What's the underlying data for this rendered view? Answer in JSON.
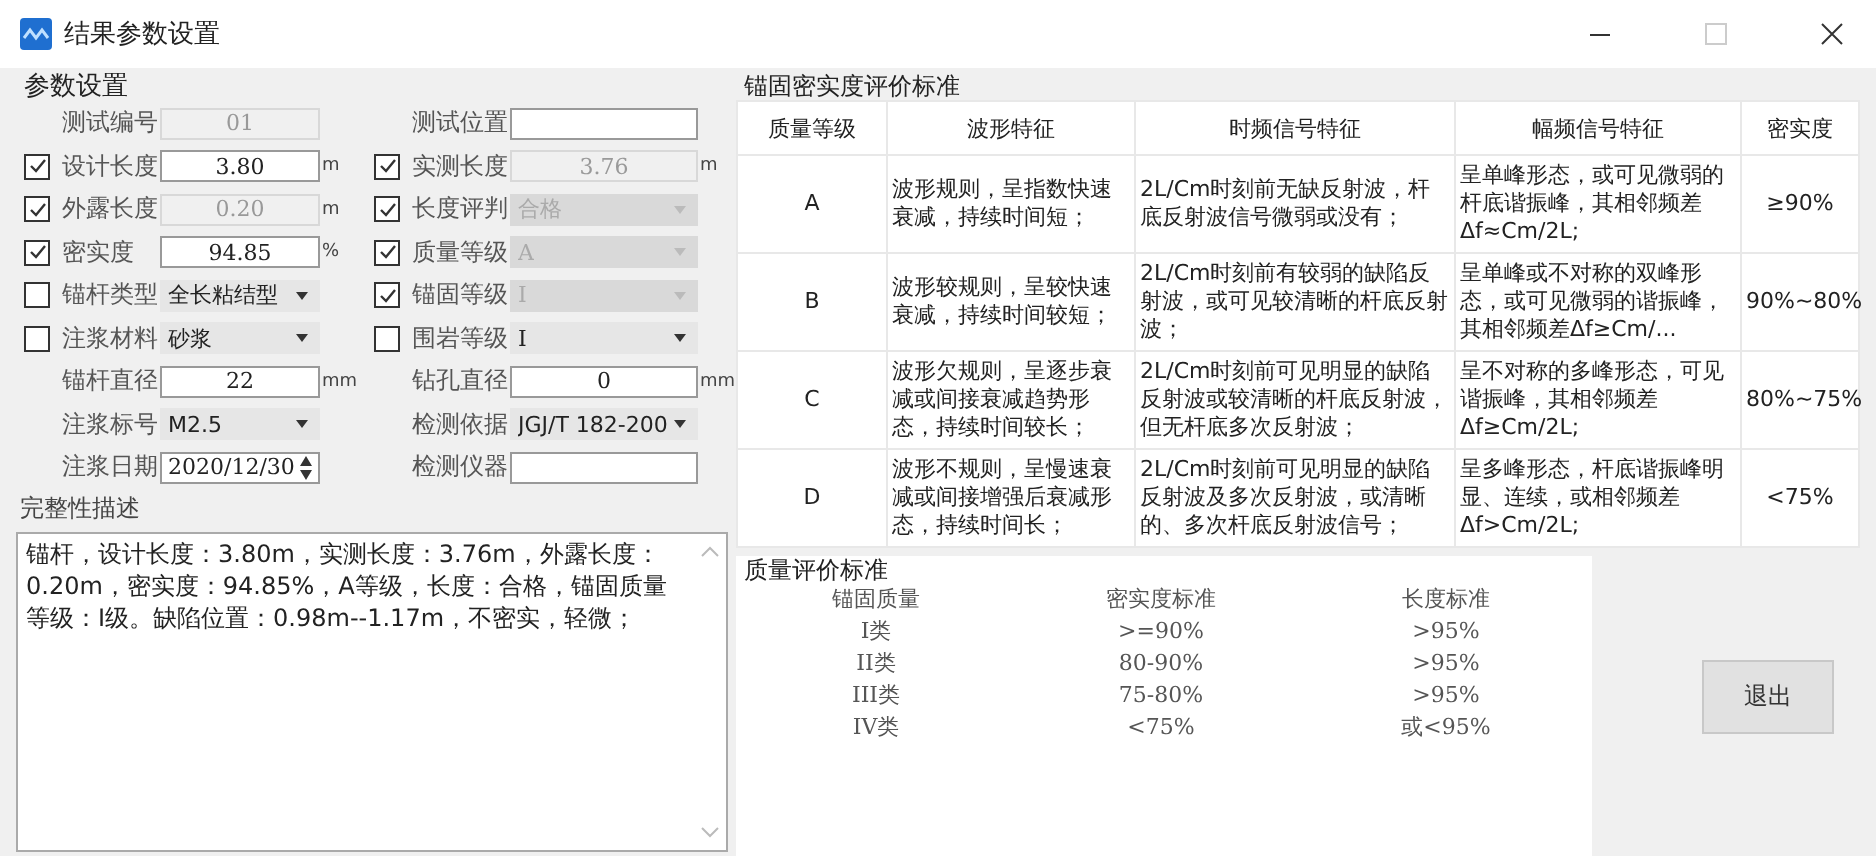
{
  "window": {
    "title": "结果参数设置"
  },
  "params": {
    "title": "参数设置",
    "rows": [
      {
        "left": {
          "label": "测试编号",
          "kind": "text",
          "value": "01",
          "disabled": true
        },
        "right": {
          "label": "测试位置",
          "kind": "text",
          "disabled": false
        }
      },
      {
        "left": {
          "label": "设计长度",
          "checked": true,
          "kind": "text",
          "value": "3.80",
          "disabled": false,
          "unit": "m"
        },
        "right": {
          "label": "实测长度",
          "checked": true,
          "kind": "text",
          "value": "3.76",
          "disabled": true,
          "unit": "m"
        }
      },
      {
        "left": {
          "label": "外露长度",
          "checked": true,
          "kind": "text",
          "value": "0.20",
          "disabled": true,
          "unit": "m"
        },
        "right": {
          "label": "长度评判",
          "checked": true,
          "kind": "select",
          "value": "合格",
          "disabled": true
        }
      },
      {
        "left": {
          "label": "密实度",
          "checked": true,
          "kind": "text",
          "value": "94.85",
          "disabled": false,
          "unit": "%"
        },
        "right": {
          "label": "质量等级",
          "checked": true,
          "kind": "select",
          "value": "A",
          "disabled": true
        }
      },
      {
        "left": {
          "label": "锚杆类型",
          "checked": false,
          "kind": "select",
          "value": "全长粘结型",
          "disabled": false
        },
        "right": {
          "label": "锚固等级",
          "checked": true,
          "kind": "select",
          "value": "I",
          "disabled": true
        }
      },
      {
        "left": {
          "label": "注浆材料",
          "checked": false,
          "kind": "select",
          "value": "砂浆",
          "disabled": false
        },
        "right": {
          "label": "围岩等级",
          "checked": false,
          "kind": "select",
          "value": "I",
          "disabled": false
        }
      },
      {
        "left": {
          "label": "锚杆直径",
          "kind": "text",
          "value": "22",
          "disabled": false,
          "unit": "mm"
        },
        "right": {
          "label": "钻孔直径",
          "kind": "text",
          "value": "0",
          "disabled": false,
          "unit": "mm"
        }
      },
      {
        "left": {
          "label": "注浆标号",
          "kind": "select",
          "value": "M2.5",
          "disabled": false
        },
        "right": {
          "label": "检测依据",
          "kind": "select",
          "value": "JGJ/T 182-200",
          "disabled": false
        }
      },
      {
        "left": {
          "label": "注浆日期",
          "kind": "date",
          "value": "2020/12/30",
          "disabled": false
        },
        "right": {
          "label": "检测仪器",
          "kind": "text",
          "disabled": false
        }
      }
    ],
    "description_label": "完整性描述",
    "description": "锚杆，设计长度：3.80m，实测长度：3.76m，外露长度：0.20m，密实度：94.85%，A等级，长度：合格，锚固质量等级：I级。缺陷位置：0.98m--1.17m，不密实，轻微；"
  },
  "density_standard": {
    "title": "锚固密实度评价标准",
    "columns": [
      "质量等级",
      "波形特征",
      "时频信号特征",
      "幅频信号特征",
      "密实度"
    ],
    "rows": [
      [
        "A",
        "波形规则，呈指数快速衰减，持续时间短；",
        "2L/Cm时刻前无缺反射波，杆底反射波信号微弱或没有；",
        "呈单峰形态，或可见微弱的杆底谐振峰，其相邻频差Δf≈Cm/2L;",
        "≥90%"
      ],
      [
        "B",
        "波形较规则，呈较快速衰减，持续时间较短；",
        "2L/Cm时刻前有较弱的缺陷反射波，或可见较清晰的杆底反射波；",
        "呈单峰或不对称的双峰形态，或可见微弱的谐振峰，其相邻频差Δf≥Cm/...",
        "90%~80%"
      ],
      [
        "C",
        "波形欠规则，呈逐步衰减或间接衰减趋势形态，持续时间较长；",
        "2L/Cm时刻前可见明显的缺陷反射波或较清晰的杆底反射波，但无杆底多次反射波；",
        "呈不对称的多峰形态，可见谐振峰，其相邻频差Δf≥Cm/2L;",
        "80%~75%"
      ],
      [
        "D",
        "波形不规则，呈慢速衰减或间接增强后衰减形态，持续时间长；",
        "2L/Cm时刻前可见明显的缺陷反射波及多次反射波，或清晰的、多次杆底反射波信号；",
        "呈多峰形态，杆底谐振峰明显、连续，或相邻频差Δf>Cm/2L;",
        "<75%"
      ]
    ]
  },
  "quality_standard": {
    "title": "质量评价标准",
    "columns": [
      "锚固质量",
      "密实度标准",
      "长度标准"
    ],
    "rows": [
      [
        "I类",
        ">=90%",
        ">95%"
      ],
      [
        "II类",
        "80-90%",
        ">95%"
      ],
      [
        "III类",
        "75-80%",
        ">95%"
      ],
      [
        "IV类",
        "<75%",
        "或<95%"
      ]
    ]
  },
  "exit_button": "退出"
}
